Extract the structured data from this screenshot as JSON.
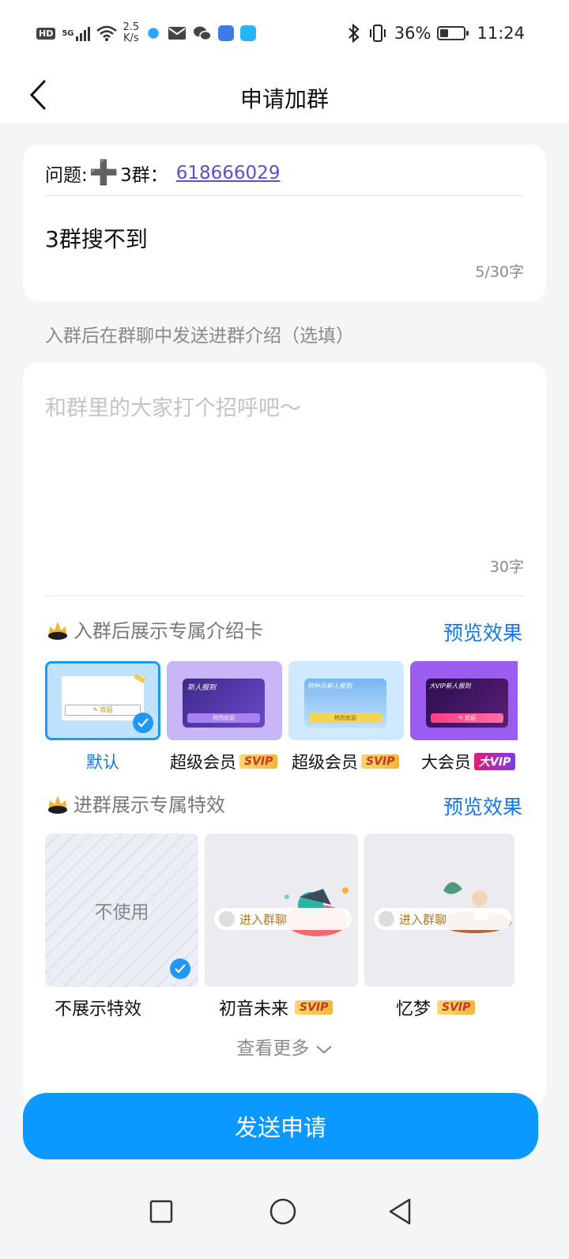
{
  "status_bar": {
    "hd": "HD",
    "network": "5G",
    "speed_value": "2.5",
    "speed_unit": "K/s",
    "battery": "36%",
    "time": "11:24",
    "icons": [
      "bluetooth-icon",
      "vibrate-icon",
      "battery-icon",
      "wifi-icon",
      "signal-icon",
      "mail-icon",
      "wechat-icon"
    ]
  },
  "header": {
    "title": "申请加群",
    "back_icon": "chevron-left-icon"
  },
  "question": {
    "prefix": "问题:",
    "plus": "➕",
    "group_label": "3群：",
    "link": "618666029",
    "answer": "3群搜不到",
    "answer_count": "5/30字"
  },
  "intro": {
    "section_label": "入群后在群聊中发送进群介绍（选填）",
    "placeholder": "和群里的大家打个招呼吧～",
    "count": "30字"
  },
  "card_section": {
    "title": "入群后展示专属介绍卡",
    "preview": "预览效果",
    "items": [
      {
        "label": "默认",
        "badge": "",
        "selected": true,
        "inner": "✎ 欢迎"
      },
      {
        "label": "超级会员",
        "badge": "SVIP",
        "banner": "新人报到",
        "btn": "热烈欢迎"
      },
      {
        "label": "超级会员",
        "badge": "SVIP",
        "banner": "特种兵新人报到",
        "btn": "热烈欢迎"
      },
      {
        "label": "大会员",
        "badge": "大VIP",
        "banner": "大VIP新人报到",
        "btn": "✎ 欢迎"
      }
    ]
  },
  "effect_section": {
    "title": "进群展示专属特效",
    "preview": "预览效果",
    "items": [
      {
        "label": "不展示特效",
        "center": "不使用",
        "badge": "",
        "selected": true
      },
      {
        "label": "初音未来",
        "badge": "SVIP",
        "pill": "进入群聊"
      },
      {
        "label": "忆梦",
        "badge": "SVIP",
        "pill": "进入群聊"
      }
    ],
    "more": "查看更多"
  },
  "send_button": "发送申请",
  "colors": {
    "accent": "#0b99ff",
    "link": "#5a4fd6",
    "preview": "#1677e6"
  }
}
